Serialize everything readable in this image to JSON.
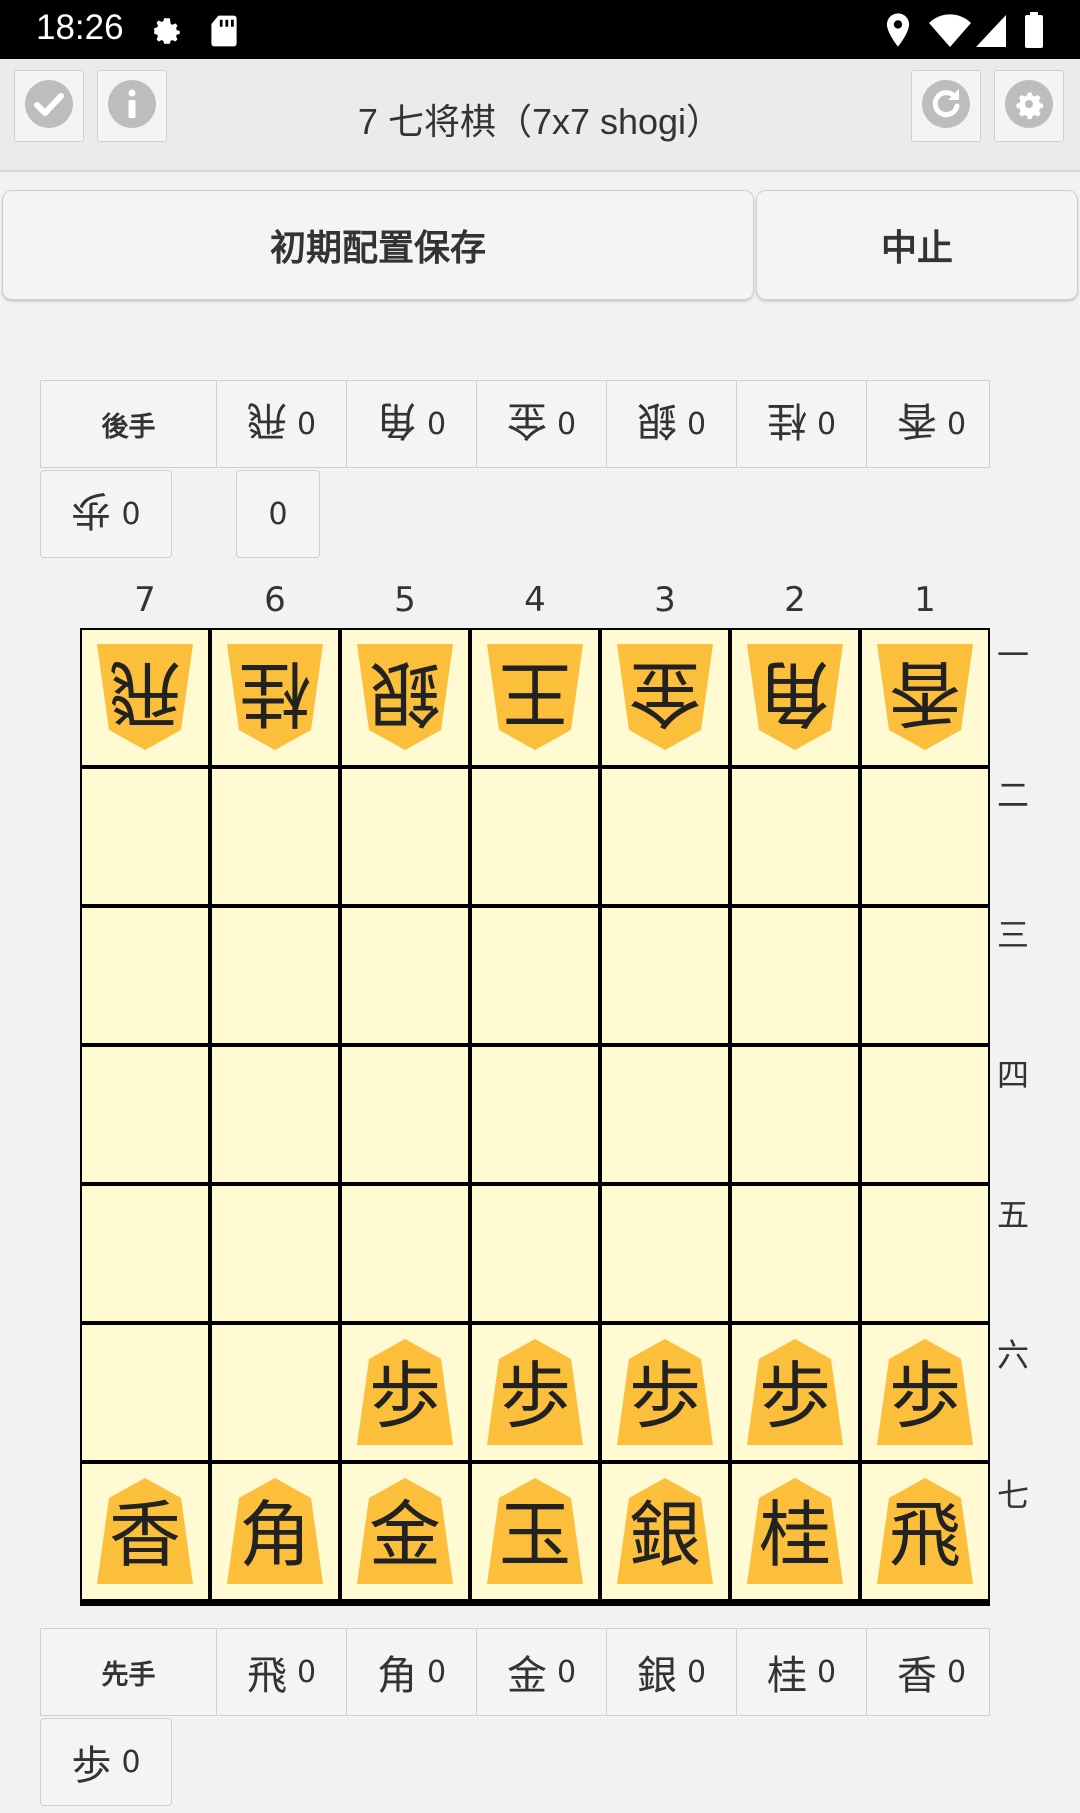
{
  "status": {
    "time": "18:26"
  },
  "app": {
    "title": "7 七将棋（7x7 shogi）"
  },
  "buttons": {
    "save": "初期配置保存",
    "cancel": "中止"
  },
  "gote": {
    "label": "後手",
    "hand": [
      {
        "piece": "飛",
        "count": "0"
      },
      {
        "piece": "角",
        "count": "0"
      },
      {
        "piece": "金",
        "count": "0"
      },
      {
        "piece": "銀",
        "count": "0"
      },
      {
        "piece": "桂",
        "count": "0"
      },
      {
        "piece": "香",
        "count": "0"
      }
    ],
    "hand2": [
      {
        "piece": "歩",
        "count": "0"
      }
    ],
    "extra_count": "0"
  },
  "sente": {
    "label": "先手",
    "hand": [
      {
        "piece": "飛",
        "count": "0"
      },
      {
        "piece": "角",
        "count": "0"
      },
      {
        "piece": "金",
        "count": "0"
      },
      {
        "piece": "銀",
        "count": "0"
      },
      {
        "piece": "桂",
        "count": "0"
      },
      {
        "piece": "香",
        "count": "0"
      }
    ],
    "hand2": [
      {
        "piece": "歩",
        "count": "0"
      }
    ]
  },
  "board": {
    "files": [
      "7",
      "6",
      "5",
      "4",
      "3",
      "2",
      "1"
    ],
    "ranks": [
      "一",
      "二",
      "三",
      "四",
      "五",
      "六",
      "七"
    ],
    "rows": [
      [
        "v飛",
        "v桂",
        "v銀",
        "v王",
        "v金",
        "v角",
        "v香"
      ],
      [
        "",
        "",
        "",
        "",
        "",
        "",
        ""
      ],
      [
        "",
        "",
        "",
        "",
        "",
        "",
        ""
      ],
      [
        "",
        "",
        "",
        "",
        "",
        "",
        ""
      ],
      [
        "",
        "",
        "",
        "",
        "",
        "",
        ""
      ],
      [
        "",
        "",
        "歩",
        "歩",
        "歩",
        "歩",
        "歩"
      ],
      [
        "香",
        "角",
        "金",
        "玉",
        "銀",
        "桂",
        "飛"
      ]
    ]
  },
  "colors": {
    "piece": "#fbbf3c",
    "square": "#fffad2",
    "line": "#000000"
  },
  "icons": {
    "statusbar": [
      "gear-icon",
      "sd-card-icon",
      "location-icon",
      "wifi-icon",
      "signal-icon",
      "battery-icon"
    ],
    "appbar": [
      "check-icon",
      "info-icon",
      "refresh-icon",
      "settings-icon"
    ]
  }
}
